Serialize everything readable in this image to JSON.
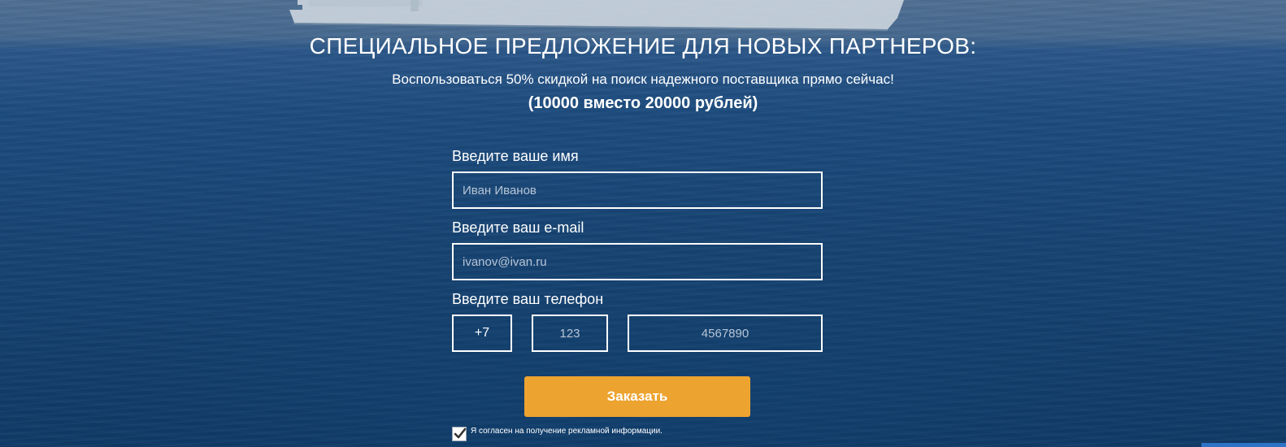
{
  "offer": {
    "headline": "СПЕЦИАЛЬНОЕ ПРЕДЛОЖЕНИЕ ДЛЯ НОВЫХ ПАРТНЕРОВ:",
    "subline": "Воспользоваться 50% скидкой на поиск надежного поставщика прямо сейчас!",
    "price": "(10000 вместо 20000 рублей)"
  },
  "form": {
    "name_label": "Введите ваше имя",
    "name_placeholder": "Иван Иванов",
    "email_label": "Введите ваш e-mail",
    "email_placeholder": "ivanov@ivan.ru",
    "phone_label": "Введите ваш телефон",
    "phone_country_code": "+7",
    "phone_area_placeholder": "123",
    "phone_number_placeholder": "4567890",
    "submit_label": "Заказать",
    "consent_checked": true,
    "consent_text": "Я согласен на получение рекламной информации."
  },
  "colors": {
    "accent": "#eda32f",
    "sea_top": "#46698f",
    "sea_bottom": "#0f3a66"
  }
}
